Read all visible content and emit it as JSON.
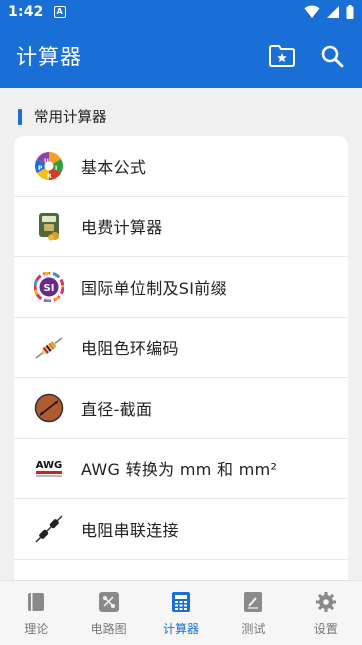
{
  "status_bar": {
    "time": "1:42",
    "notification_letter": "A"
  },
  "app_bar": {
    "title": "计算器",
    "favorites_icon": "folder-star-icon",
    "search_icon": "search-icon"
  },
  "section": {
    "title": "常用计算器"
  },
  "items": [
    {
      "label": "基本公式",
      "icon": "ohms-law-wheel-icon"
    },
    {
      "label": "电费计算器",
      "icon": "electricity-meter-icon"
    },
    {
      "label": "国际单位制及SI前缀",
      "icon": "si-units-icon"
    },
    {
      "label": "电阻色环编码",
      "icon": "resistor-color-icon"
    },
    {
      "label": "直径-截面",
      "icon": "wire-diameter-icon"
    },
    {
      "label": "AWG 转换为 mm 和 mm²",
      "icon": "awg-icon",
      "icon_text": "AWG"
    },
    {
      "label": "电阻串联连接",
      "icon": "series-resistors-icon"
    }
  ],
  "bottom_nav": [
    {
      "label": "理论",
      "icon": "book-icon",
      "active": false
    },
    {
      "label": "电路图",
      "icon": "circuit-icon",
      "active": false
    },
    {
      "label": "计算器",
      "icon": "calculator-icon",
      "active": true
    },
    {
      "label": "测试",
      "icon": "test-icon",
      "active": false
    },
    {
      "label": "设置",
      "icon": "gear-icon",
      "active": false
    }
  ],
  "colors": {
    "primary": "#1a6fd6",
    "background": "#f0f0f0",
    "card": "#ffffff"
  }
}
